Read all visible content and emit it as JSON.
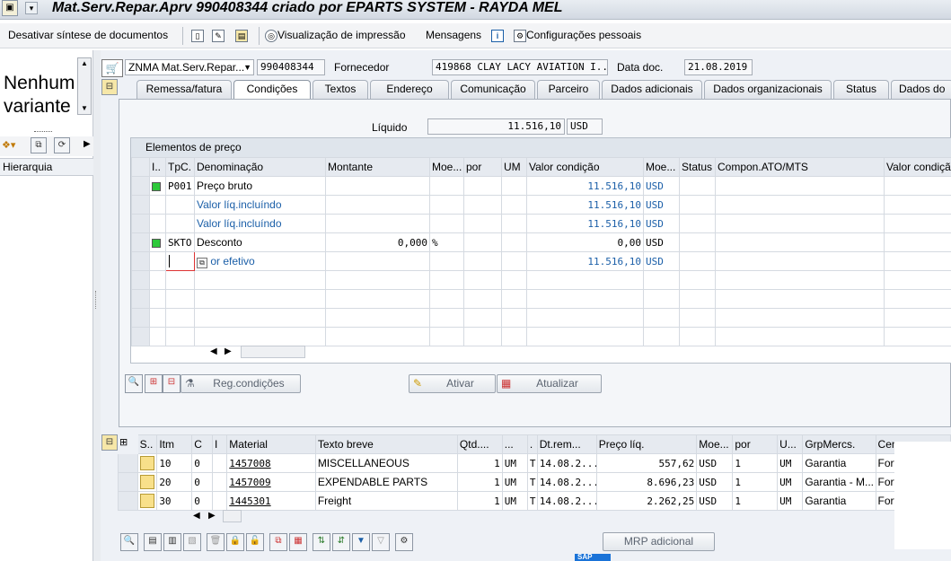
{
  "title": "Mat.Serv.Repar.Aprv 990408344 criado por EPARTS SYSTEM - RAYDA MEL",
  "toolbar": {
    "desativar": "Desativar síntese de documentos",
    "visualizacao": "Visualização de impressão",
    "mensagens": "Mensagens",
    "config": "Configurações pessoais"
  },
  "left": {
    "variant_line1": "Nenhum",
    "variant_line2": "variante",
    "hierarquia": "Hierarquia"
  },
  "header": {
    "doc_type": "ZNMA Mat.Serv.Repar...",
    "doc_number": "990408344",
    "fornecedor_label": "Fornecedor",
    "fornecedor_value": "419868 CLAY LACY AVIATION I...",
    "data_doc_label": "Data doc.",
    "data_doc_value": "21.08.2019"
  },
  "tabs": [
    "Remessa/fatura",
    "Condições",
    "Textos",
    "Endereço",
    "Comunicação",
    "Parceiro",
    "Dados adicionais",
    "Dados organizacionais",
    "Status",
    "Dados do"
  ],
  "liquido": {
    "label": "Líquido",
    "value": "11.516,10",
    "currency": "USD"
  },
  "pricing": {
    "title": "Elementos de preço",
    "headers": [
      "I..",
      "TpC.",
      "Denominação",
      "Montante",
      "Moe...",
      "por",
      "UM",
      "Valor condição",
      "Moe...",
      "Status",
      "Compon.ATO/MTS",
      "Valor condição"
    ],
    "rows": [
      {
        "tpc": "P001",
        "denominacao": "Preço bruto",
        "montante": "",
        "moe": "",
        "valor": "11.516,10",
        "moe2": "USD"
      },
      {
        "tpc": "",
        "denominacao": "Valor líq.incluíndo",
        "montante": "",
        "moe": "",
        "valor": "11.516,10",
        "moe2": "USD"
      },
      {
        "tpc": "",
        "denominacao": "Valor líq.incluíndo",
        "montante": "",
        "moe": "",
        "valor": "11.516,10",
        "moe2": "USD"
      },
      {
        "tpc": "SKTO",
        "denominacao": "Desconto",
        "montante": "0,000",
        "moe": "%",
        "valor": "0,00",
        "moe2": "USD"
      },
      {
        "tpc": "",
        "denominacao": "or efetivo",
        "montante": "",
        "moe": "",
        "valor": "11.516,10",
        "moe2": "USD"
      }
    ]
  },
  "buttons": {
    "reg": "Reg.condições",
    "ativar": "Ativar",
    "atualizar": "Atualizar",
    "mrp": "MRP adicional"
  },
  "items": {
    "headers": [
      "S..",
      "Itm",
      "C",
      "I",
      "Material",
      "Texto breve",
      "Qtd....",
      "...",
      ".",
      "Dt.rem...",
      "Preço líq.",
      "Moe...",
      "por",
      "U...",
      "GrpMercs.",
      "Cen."
    ],
    "rows": [
      {
        "itm": "10",
        "c": "0",
        "material": "1457008",
        "texto": "MISCELLANEOUS",
        "qtd": "1",
        "um": "UM",
        "t": "T",
        "dt": "14.08.2...",
        "preco": "557,62",
        "moe": "USD",
        "por": "1",
        "u": "UM",
        "grp": "Garantia",
        "cen": "Fort Lauderdal"
      },
      {
        "itm": "20",
        "c": "0",
        "material": "1457009",
        "texto": "EXPENDABLE PARTS",
        "qtd": "1",
        "um": "UM",
        "t": "T",
        "dt": "14.08.2...",
        "preco": "8.696,23",
        "moe": "USD",
        "por": "1",
        "u": "UM",
        "grp": "Garantia - M...",
        "cen": "Fort Lauderdal"
      },
      {
        "itm": "30",
        "c": "0",
        "material": "1445301",
        "texto": "Freight",
        "qtd": "1",
        "um": "UM",
        "t": "T",
        "dt": "14.08.2...",
        "preco": "2.262,25",
        "moe": "USD",
        "por": "1",
        "u": "UM",
        "grp": "Garantia",
        "cen": "Fort Lauderdal"
      }
    ]
  },
  "footer_mark": "SAP"
}
